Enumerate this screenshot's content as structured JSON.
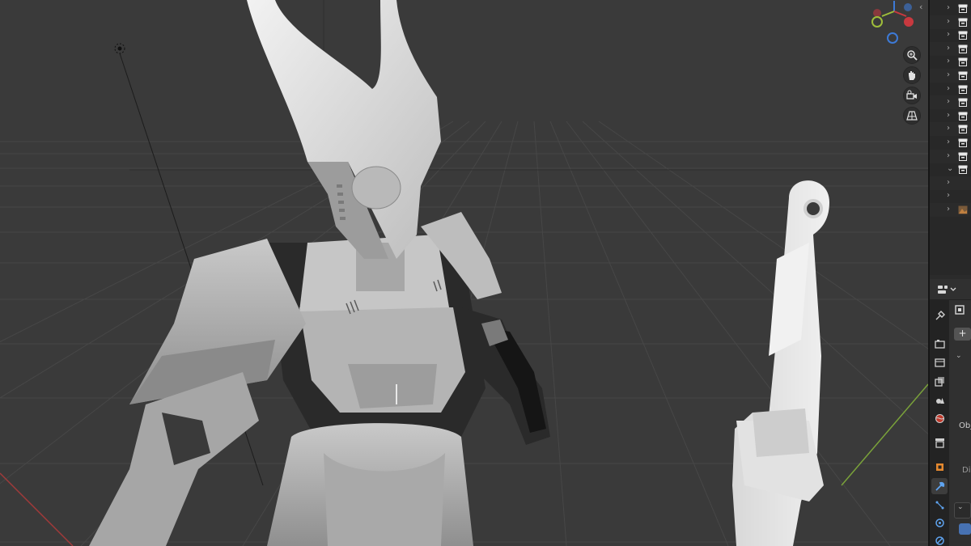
{
  "app": {
    "name": "Blender 3D viewport"
  },
  "viewport": {
    "nav_tools": [
      {
        "name": "zoom-icon",
        "symbol": "🔍"
      },
      {
        "name": "hand-pan-icon",
        "symbol": "✋"
      },
      {
        "name": "camera-view-icon",
        "symbol": "🎥"
      },
      {
        "name": "perspective-grid-icon",
        "symbol": "▦"
      }
    ],
    "gizmo": {
      "x_label": "",
      "y_label": "",
      "z_label": ""
    },
    "colors": {
      "background": "#3d3d3d",
      "grid": "#4a4a4a",
      "x_axis": "#a03a3a",
      "y_axis": "#7aa23a"
    }
  },
  "outliner": {
    "rows": [
      {
        "expander": "›",
        "icon": "collection"
      },
      {
        "expander": "›",
        "icon": "collection"
      },
      {
        "expander": "›",
        "icon": "collection"
      },
      {
        "expander": "›",
        "icon": "collection"
      },
      {
        "expander": "›",
        "icon": "collection"
      },
      {
        "expander": "›",
        "icon": "collection"
      },
      {
        "expander": "›",
        "icon": "collection"
      },
      {
        "expander": "›",
        "icon": "collection"
      },
      {
        "expander": "›",
        "icon": "collection"
      },
      {
        "expander": "›",
        "icon": "collection"
      },
      {
        "expander": "›",
        "icon": "collection"
      },
      {
        "expander": "›",
        "icon": "collection"
      },
      {
        "expander": "⌄",
        "icon": "collection"
      },
      {
        "expander": "›",
        "icon": "none"
      },
      {
        "expander": "›",
        "icon": "none"
      },
      {
        "expander": "›",
        "icon": "image"
      }
    ]
  },
  "properties": {
    "add_label": "+",
    "partial_text_1": "Obj",
    "partial_text_2": "Di",
    "tabs": [
      "tool-icon",
      "render-icon",
      "output-icon",
      "view-layer-icon",
      "scene-icon",
      "world-icon",
      "collection-icon",
      "object-icon",
      "modifier-icon",
      "particles-icon",
      "physics-icon",
      "constraints-icon"
    ]
  }
}
